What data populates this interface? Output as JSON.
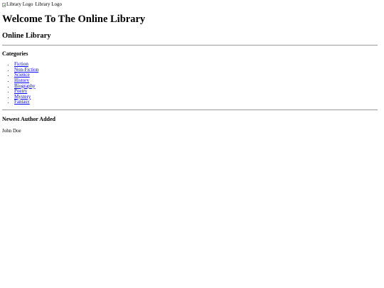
{
  "header": {
    "logo_alt": "Library Logo",
    "logo_text": "Library Logo",
    "title": "Welcome To The Online Library",
    "subtitle": "Online Library"
  },
  "categories": {
    "heading": "Categories",
    "items": [
      {
        "label": "Fiction"
      },
      {
        "label": "Non-Fiction"
      },
      {
        "label": "Science"
      },
      {
        "label": "History"
      },
      {
        "label": "Biography"
      },
      {
        "label": "Poetry"
      },
      {
        "label": "Mystery"
      },
      {
        "label": "Fantasy"
      }
    ]
  },
  "newest_author": {
    "heading": "Newest Author Added",
    "name": "John Doe"
  },
  "colors": {
    "link": "#0000ee",
    "rule": "#9a9a9a",
    "text": "#000000",
    "background": "#ffffff"
  },
  "icons": {
    "logo": "broken-image-icon"
  }
}
